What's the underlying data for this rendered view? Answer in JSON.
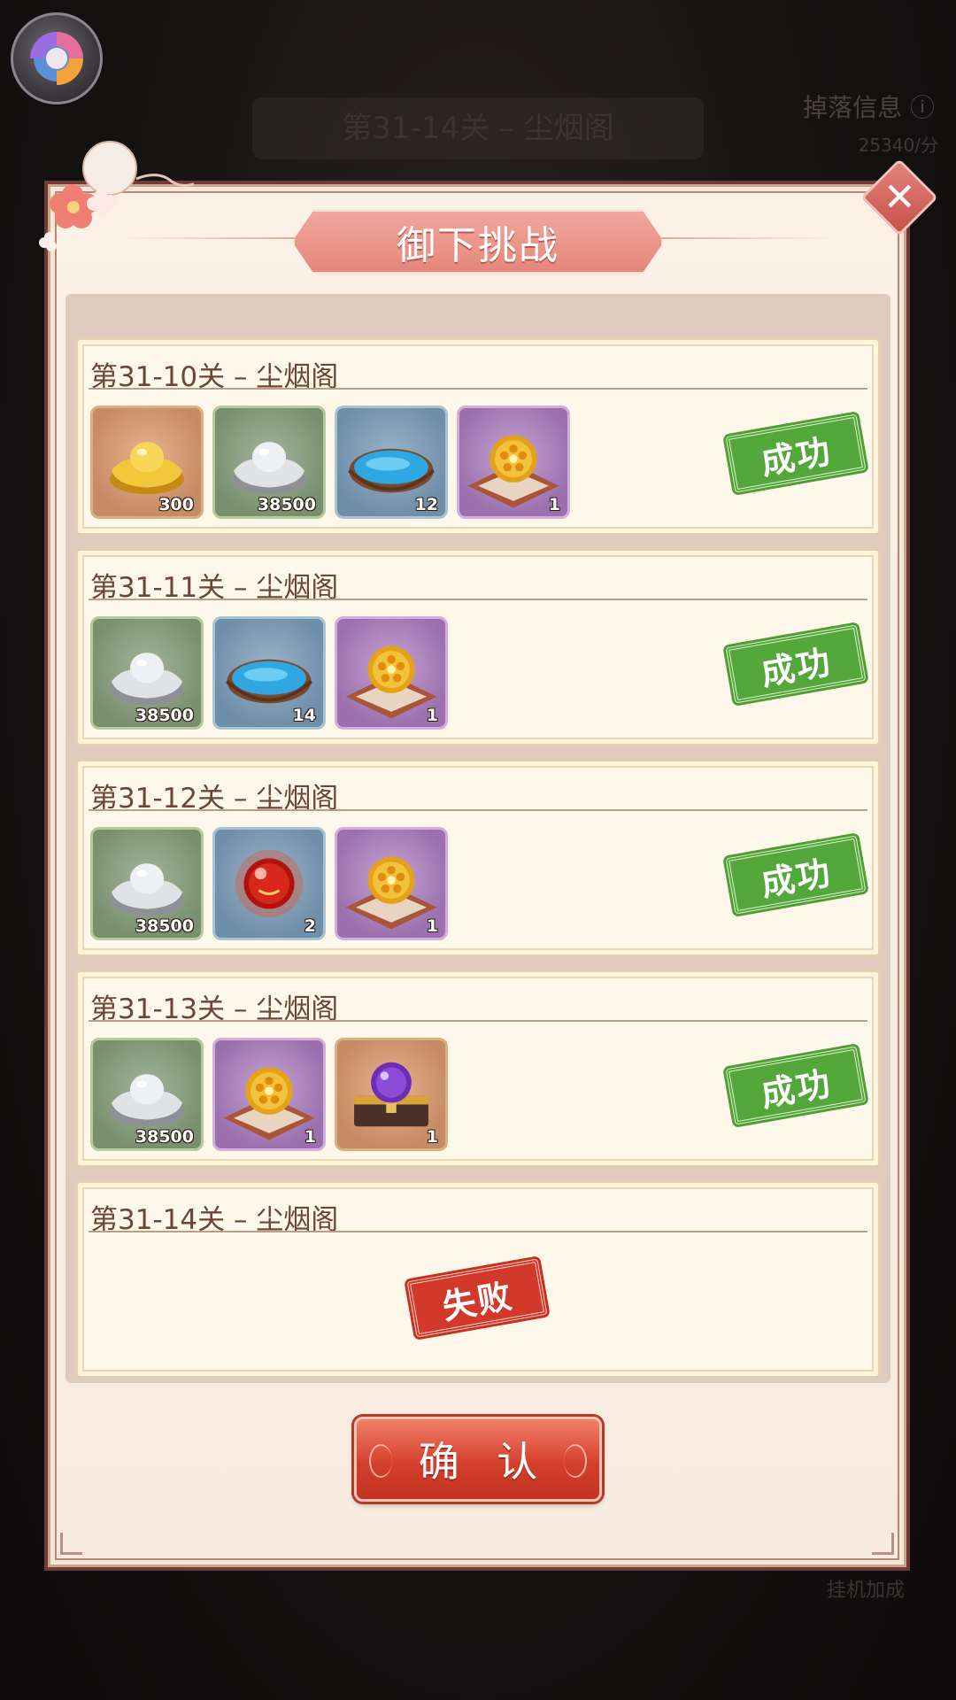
{
  "background": {
    "stage_title": "第31-14关 – 尘烟阁",
    "drop_info": "掉落信息 ⓘ",
    "drop_value": "25340/分",
    "bottom_text": "挂机加成"
  },
  "dialog": {
    "title": "御下挑战",
    "confirm_label": "确 认",
    "close_icon": "close-icon",
    "stages": [
      {
        "title": "第31-10关 – 尘烟阁",
        "result": "成功",
        "items": [
          {
            "icon": "gold-ingot-icon",
            "count": "300"
          },
          {
            "icon": "silver-ingot-icon",
            "count": "38500"
          },
          {
            "icon": "blue-sand-bowl-icon",
            "count": "12"
          },
          {
            "icon": "golden-orb-icon",
            "count": "1"
          }
        ]
      },
      {
        "title": "第31-11关 – 尘烟阁",
        "result": "成功",
        "items": [
          {
            "icon": "silver-ingot-icon",
            "count": "38500"
          },
          {
            "icon": "blue-sand-bowl-icon",
            "count": "14"
          },
          {
            "icon": "golden-orb-icon",
            "count": "1"
          }
        ]
      },
      {
        "title": "第31-12关 – 尘烟阁",
        "result": "成功",
        "items": [
          {
            "icon": "silver-ingot-icon",
            "count": "38500"
          },
          {
            "icon": "red-orb-icon",
            "count": "2"
          },
          {
            "icon": "golden-orb-icon",
            "count": "1"
          }
        ]
      },
      {
        "title": "第31-13关 – 尘烟阁",
        "result": "成功",
        "items": [
          {
            "icon": "silver-ingot-icon",
            "count": "38500"
          },
          {
            "icon": "golden-orb-icon",
            "count": "1"
          },
          {
            "icon": "purple-orb-chest-icon",
            "count": "1"
          }
        ]
      },
      {
        "title": "第31-14关 – 尘烟阁",
        "result": "失败",
        "items": []
      }
    ]
  },
  "colors": {
    "success": "#54a83b",
    "fail": "#d3392b",
    "title_banner": "#e5877a",
    "panel_bg": "#fbf1e6"
  }
}
